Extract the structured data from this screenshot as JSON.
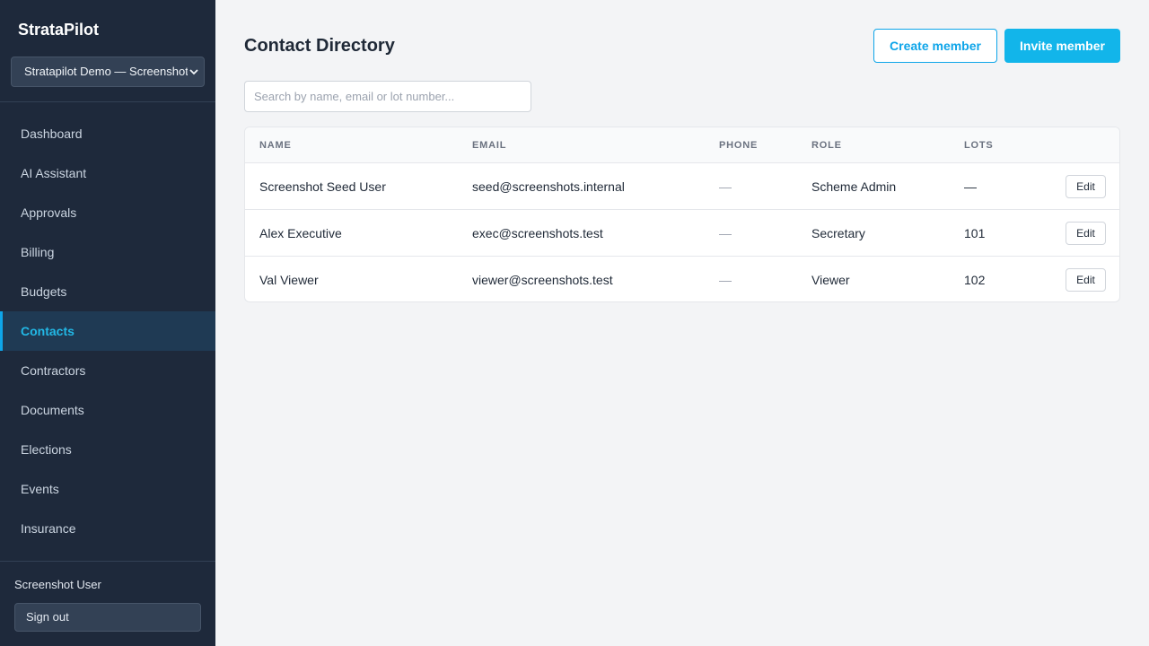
{
  "sidebar": {
    "brand": "StrataPilot",
    "scheme_select": "Stratapilot Demo — Screenshot",
    "items": [
      {
        "label": "Dashboard",
        "active": false
      },
      {
        "label": "AI Assistant",
        "active": false
      },
      {
        "label": "Approvals",
        "active": false
      },
      {
        "label": "Billing",
        "active": false
      },
      {
        "label": "Budgets",
        "active": false
      },
      {
        "label": "Contacts",
        "active": true
      },
      {
        "label": "Contractors",
        "active": false
      },
      {
        "label": "Documents",
        "active": false
      },
      {
        "label": "Elections",
        "active": false
      },
      {
        "label": "Events",
        "active": false
      },
      {
        "label": "Insurance",
        "active": false
      }
    ],
    "user_name": "Screenshot User",
    "sign_out": "Sign out"
  },
  "main": {
    "title": "Contact Directory",
    "create_button": "Create member",
    "invite_button": "Invite member",
    "search_placeholder": "Search by name, email or lot number...",
    "table": {
      "headers": {
        "name": "NAME",
        "email": "EMAIL",
        "phone": "PHONE",
        "role": "ROLE",
        "lots": "LOTS"
      },
      "rows": [
        {
          "name": "Screenshot Seed User",
          "email": "seed@screenshots.internal",
          "phone": "—",
          "role": "Scheme Admin",
          "lots": "—",
          "action": "Edit"
        },
        {
          "name": "Alex Executive",
          "email": "exec@screenshots.test",
          "phone": "—",
          "role": "Secretary",
          "lots": "101",
          "action": "Edit"
        },
        {
          "name": "Val Viewer",
          "email": "viewer@screenshots.test",
          "phone": "—",
          "role": "Viewer",
          "lots": "102",
          "action": "Edit"
        }
      ]
    }
  },
  "colors": {
    "sidebar_bg": "#1e293b",
    "accent": "#0ea5e9",
    "page_bg": "#f3f4f6"
  }
}
